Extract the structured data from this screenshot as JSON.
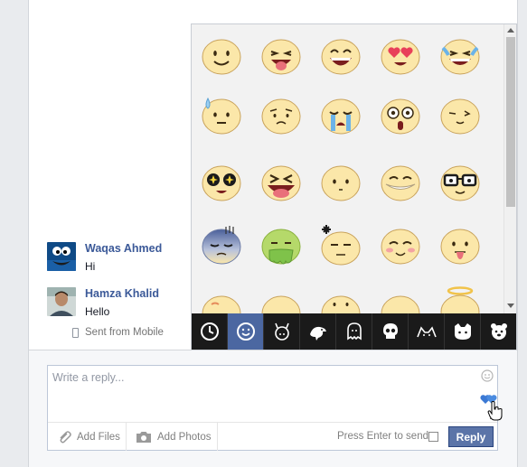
{
  "messages": [
    {
      "name": "Waqas Ahmed",
      "text": "Hi",
      "avatar": "cookie-monster-avatar"
    },
    {
      "name": "Hamza Khalid",
      "text": "Hello",
      "avatar": "person-photo-avatar"
    }
  ],
  "sent_from": "Sent from Mobile",
  "emoji_panel": {
    "grid": [
      [
        "smile",
        "tongue",
        "grin",
        "heart-eyes",
        "tears-of-joy"
      ],
      [
        "sweat",
        "worried",
        "crying",
        "surprised",
        "wink"
      ],
      [
        "star-eyes",
        "squint-tongue",
        "neutral",
        "grin-teeth",
        "glasses"
      ],
      [
        "gloom",
        "sick",
        "angry",
        "blush",
        "tongue-out"
      ],
      [
        "cut-off",
        "cut-off",
        "cut-off",
        "cut-off",
        "angel"
      ]
    ],
    "tabs": [
      "clock-icon",
      "smiley-face-icon",
      "horned-icon",
      "bird-icon",
      "ghost-icon",
      "skull-icon",
      "cat-ears-icon",
      "cat-icon",
      "bear-icon"
    ],
    "active_tab": 1
  },
  "composer": {
    "placeholder": "Write a reply...",
    "add_files": "Add Files",
    "add_photos": "Add Photos",
    "press_enter": "Press Enter to send",
    "reply": "Reply"
  },
  "colors": {
    "link": "#3b5998",
    "active_tab": "#4b67a1",
    "reply_button": "#5b74a8",
    "emoji_face": "#fbe7a9"
  }
}
